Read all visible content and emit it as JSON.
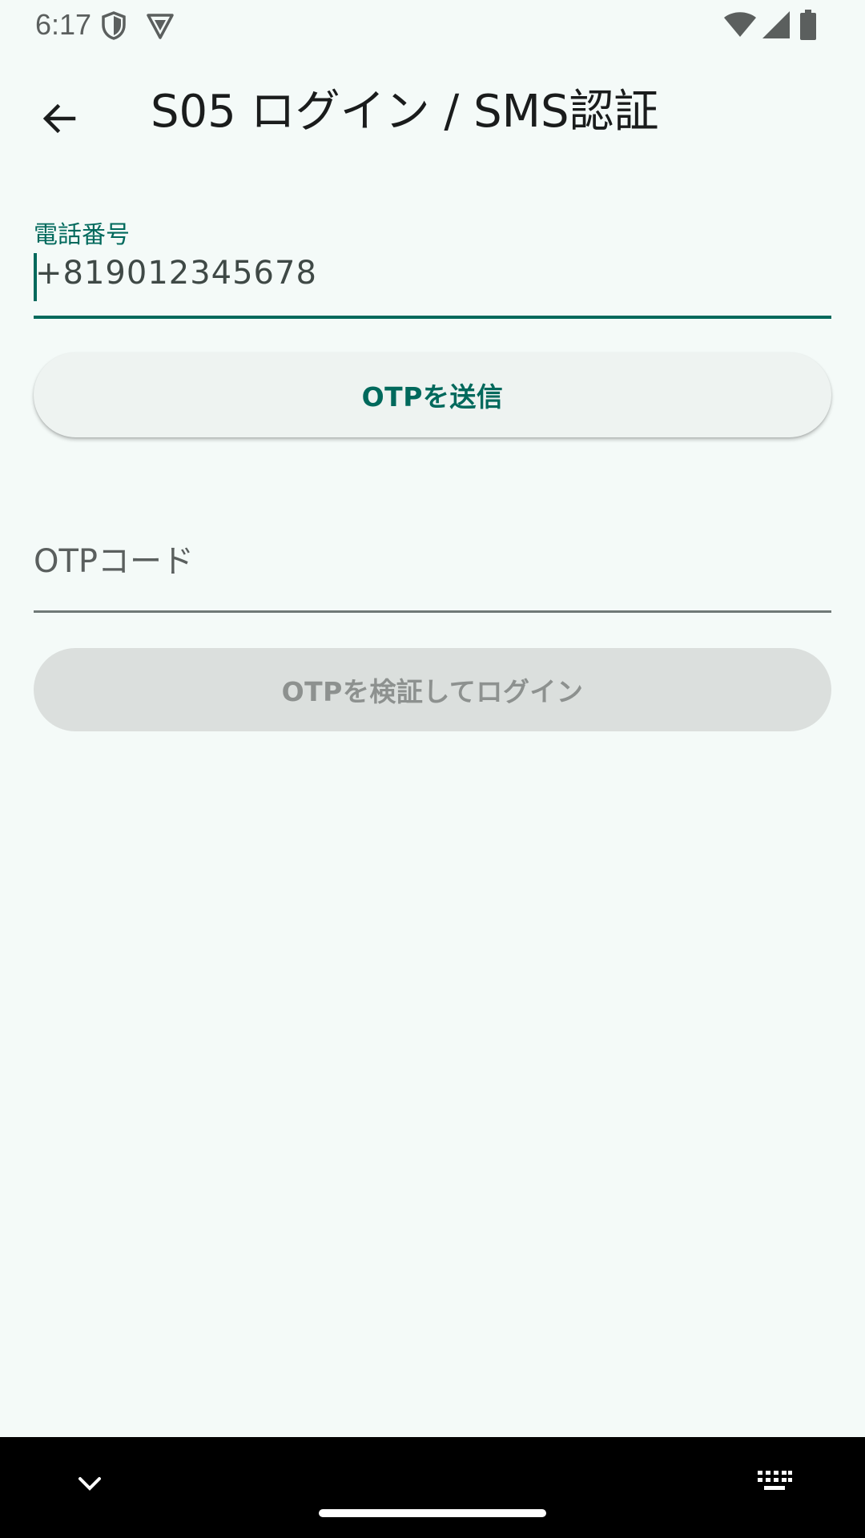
{
  "status_bar": {
    "time": "6:17",
    "left_icons": [
      "shield-icon",
      "vpn-triangle-icon"
    ],
    "right_icons": [
      "wifi-icon",
      "signal-icon",
      "battery-icon"
    ]
  },
  "app_bar": {
    "back_icon": "arrow-back-icon",
    "title": "S05 ログイン / SMS認証"
  },
  "phone_field": {
    "label": "電話番号",
    "value": "+819012345678",
    "focused": true
  },
  "send_otp_button": {
    "label": "OTPを送信"
  },
  "otp_field": {
    "placeholder": "OTPコード",
    "value": ""
  },
  "verify_button": {
    "label": "OTPを検証してログイン",
    "enabled": false
  },
  "nav_bar": {
    "icons": [
      "chevron-down-icon",
      "home-handle",
      "keyboard-icon"
    ]
  },
  "colors": {
    "background": "#f4faf8",
    "primary": "#00695c",
    "disabled_bg": "#dbdfdd",
    "disabled_text": "#8d918f"
  }
}
